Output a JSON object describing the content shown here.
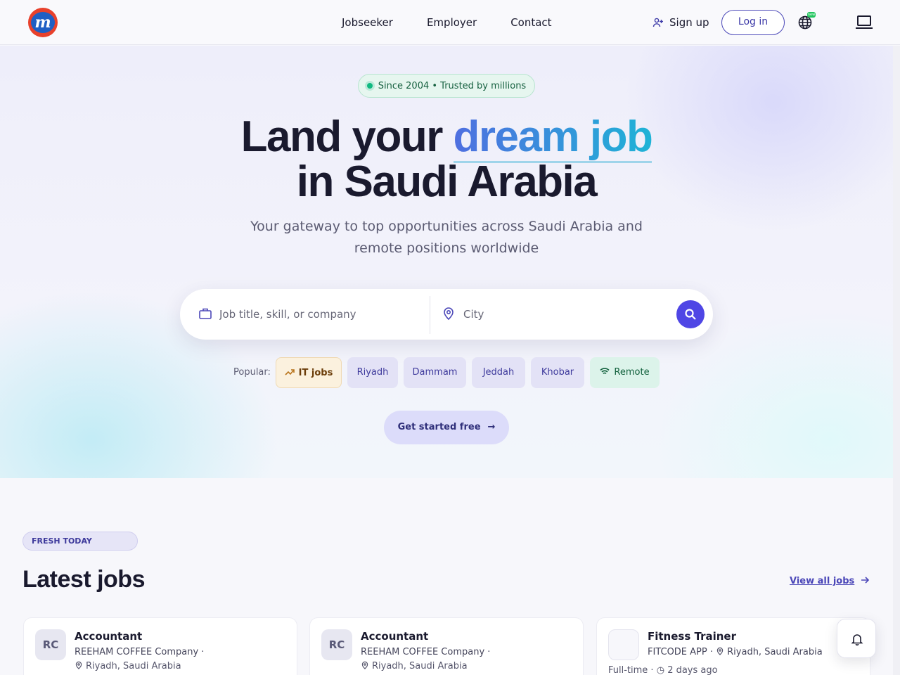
{
  "header": {
    "logo_letter": "m",
    "nav": [
      "Jobseeker",
      "Employer",
      "Contact"
    ],
    "signup_label": "Sign up",
    "login_label": "Log in",
    "language_badge": "new"
  },
  "hero": {
    "badge": "Since 2004 • Trusted by millions",
    "title_part1": "Land your ",
    "title_accent": "dream job",
    "title_line2": "in Saudi Arabia",
    "subtitle": "Your gateway to top opportunities across Saudi Arabia and remote positions worldwide",
    "search": {
      "job_placeholder": "Job title, skill, or company",
      "city_placeholder": "City"
    },
    "popular_label": "Popular:",
    "chips": [
      "IT jobs",
      "Riyadh",
      "Dammam",
      "Jeddah",
      "Khobar",
      "Remote"
    ],
    "cta_label": "Get started free"
  },
  "latest": {
    "badge": "FRESH TODAY",
    "title": "Latest jobs",
    "view_all": "View all jobs",
    "jobs": [
      {
        "logo": "RC",
        "title": "Accountant",
        "company": "REEHAM COFFEE Company",
        "location": "Riyadh, Saudi Arabia"
      },
      {
        "logo": "RC",
        "title": "Accountant",
        "company": "REEHAM COFFEE Company",
        "location": "Riyadh, Saudi Arabia"
      },
      {
        "logo": "",
        "title": "Fitness Trainer",
        "company": "FITCODE APP",
        "location": "Riyadh, Saudi Arabia",
        "type": "Full-time",
        "posted": "2 days ago"
      }
    ]
  },
  "colors": {
    "primary": "#4f46e5",
    "accent_gradient_start": "#4f6fe0",
    "accent_gradient_end": "#1fb3d6",
    "badge_green": "#10b981"
  },
  "icons": {
    "signup": "user-plus-icon",
    "language": "globe-icon",
    "device": "laptop-icon",
    "job_field": "briefcase-icon",
    "city_field": "map-pin-icon",
    "search_button": "search-icon",
    "it_chip": "trending-up-icon",
    "remote_chip": "wifi-icon",
    "cta": "arrow-right-icon",
    "alerts": "bell-icon"
  }
}
